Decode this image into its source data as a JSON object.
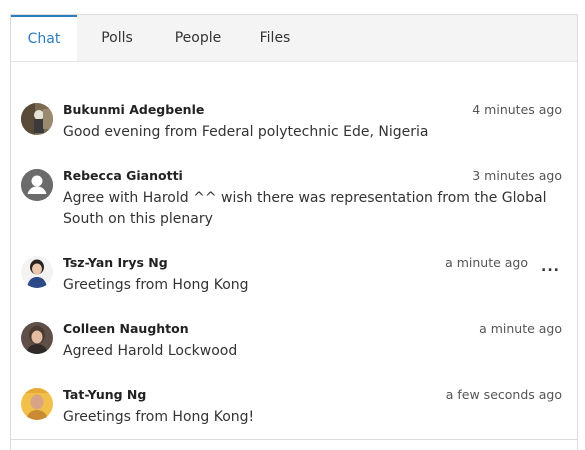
{
  "tabs": [
    {
      "label": "Chat",
      "active": true
    },
    {
      "label": "Polls",
      "active": false
    },
    {
      "label": "People",
      "active": false
    },
    {
      "label": "Files",
      "active": false
    }
  ],
  "accent_color": "#2f7bbf",
  "messages": [
    {
      "author": "Bukunmi Adegbenle",
      "time": "4 minutes ago",
      "text": "Good evening from Federal polytechnic Ede, Nigeria",
      "avatar": "photo"
    },
    {
      "author": "Rebecca Gianotti",
      "time": "3 minutes ago",
      "text": "Agree with Harold ^^ wish there was representation from the Global South on this plenary",
      "avatar": "default-user-icon"
    },
    {
      "author": "Tsz-Yan Irys Ng",
      "time": "a minute ago",
      "text": "Greetings from Hong Kong",
      "avatar": "photo",
      "menu": "..."
    },
    {
      "author": "Colleen Naughton",
      "time": "a minute ago",
      "text": "Agreed Harold Lockwood",
      "avatar": "photo"
    },
    {
      "author": "Tat-Yung Ng",
      "time": "a few seconds ago",
      "text": "Greetings from Hong Kong!",
      "avatar": "photo"
    }
  ]
}
